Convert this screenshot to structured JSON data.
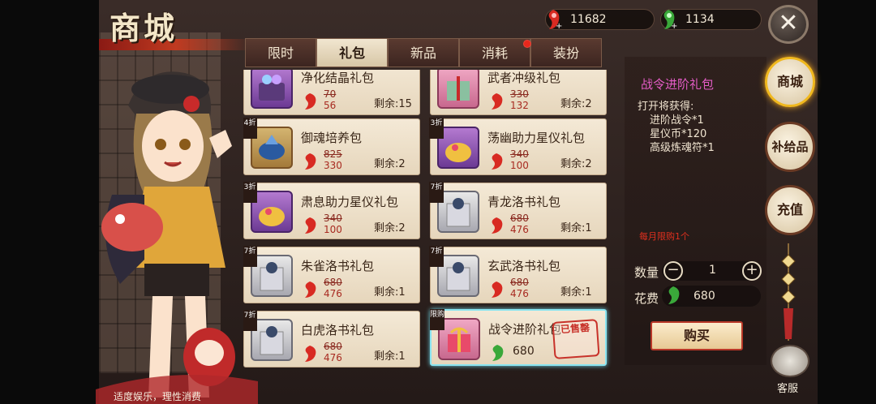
{
  "title": "商城",
  "currency": {
    "red": "11682",
    "green": "1134"
  },
  "close_label": "✕",
  "tabs": [
    {
      "label": "限时"
    },
    {
      "label": "礼包"
    },
    {
      "label": "新品"
    },
    {
      "label": "消耗"
    },
    {
      "label": "装扮"
    }
  ],
  "items": [
    {
      "name": "净化结晶礼包",
      "old": "70",
      "new": "56",
      "remain": "剩余:15",
      "tag": ""
    },
    {
      "name": "武者冲级礼包",
      "old": "330",
      "new": "132",
      "remain": "剩余:2",
      "tag": ""
    },
    {
      "name": "御魂培养包",
      "old": "825",
      "new": "330",
      "remain": "剩余:2",
      "tag": "4折"
    },
    {
      "name": "荡幽助力星仪礼包",
      "old": "340",
      "new": "100",
      "remain": "剩余:2",
      "tag": "3折"
    },
    {
      "name": "肃息助力星仪礼包",
      "old": "340",
      "new": "100",
      "remain": "剩余:2",
      "tag": "3折"
    },
    {
      "name": "青龙洛书礼包",
      "old": "680",
      "new": "476",
      "remain": "剩余:1",
      "tag": "7折"
    },
    {
      "name": "朱雀洛书礼包",
      "old": "680",
      "new": "476",
      "remain": "剩余:1",
      "tag": "7折"
    },
    {
      "name": "玄武洛书礼包",
      "old": "680",
      "new": "476",
      "remain": "剩余:1",
      "tag": "7折"
    },
    {
      "name": "白虎洛书礼包",
      "old": "680",
      "new": "476",
      "remain": "剩余:1",
      "tag": "7折"
    },
    {
      "name": "战令进阶礼包",
      "price": "680",
      "stamp": "已售罄",
      "tag": "限购"
    }
  ],
  "detail": {
    "title": "战令进阶礼包",
    "open_text": "打开将获得:",
    "rewards": [
      "进阶战令*1",
      "星仪币*120",
      "高级炼魂符*1"
    ],
    "limit": "每月限购1个",
    "qty_label": "数量",
    "qty": "1",
    "minus": "−",
    "plus": "+",
    "cost_label": "花费",
    "cost": "680",
    "buy": "购买"
  },
  "side_nav": [
    {
      "label": "商城"
    },
    {
      "label": "补给品"
    },
    {
      "label": "充值"
    }
  ],
  "service_label": "客服",
  "footer_note": "适度娱乐，理性消费",
  "colors": {
    "accent_gold": "#f0b81e",
    "discount_red": "#a82a20",
    "title_pink": "#e45cc6",
    "limit_red": "#e0301e"
  }
}
